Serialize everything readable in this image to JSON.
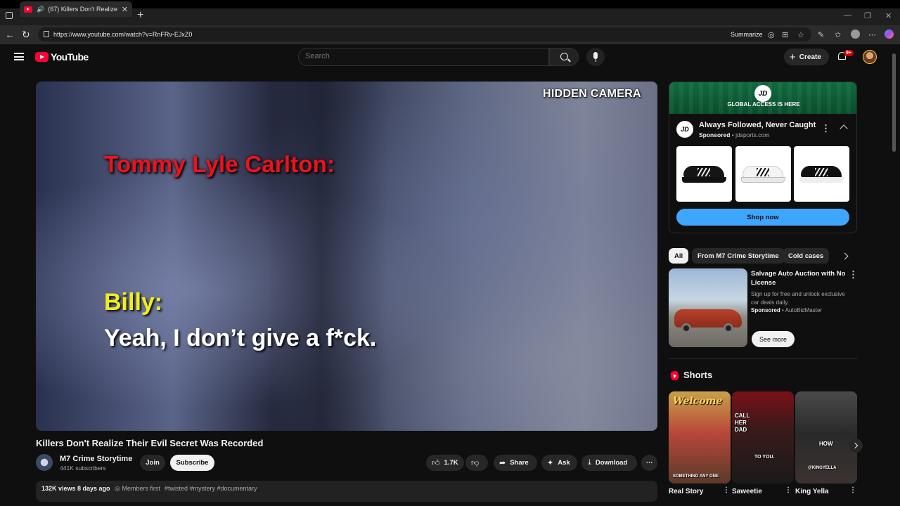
{
  "browser": {
    "tab_title": "(67) Killers Don't Realize Th...",
    "url": "https://www.youtube.com/watch?v=RnFRv-EJxZ0",
    "summarize_label": "Summarize"
  },
  "header": {
    "logo_text": "YouTube",
    "search_placeholder": "Search",
    "create_label": "Create",
    "notification_count": "9+"
  },
  "video": {
    "overlay_label": "HIDDEN CAMERA",
    "caption_speaker1": "Tommy Lyle Carlton:",
    "caption_speaker2": "Billy:",
    "caption_line": "Yeah, I don’t give a f*ck.",
    "title": "Killers Don't Realize Their Evil Secret Was Recorded"
  },
  "channel": {
    "name": "M7 Crime Storytime",
    "subscribers": "441K subscribers",
    "join_label": "Join",
    "subscribe_label": "Subscribe"
  },
  "actions": {
    "likes": "1.7K",
    "share_label": "Share",
    "ask_label": "Ask",
    "download_label": "Download"
  },
  "description": {
    "views_date": "132K views  8 days ago",
    "members": "Members first",
    "tags": "#twisted #mystery #documentary"
  },
  "ad1": {
    "banner_logo": "JD",
    "banner_text": "GLOBAL ACCESS IS HERE",
    "logo": "JD",
    "title": "Always Followed, Never Caught",
    "sponsored": "Sponsored",
    "domain": " • jdsports.com",
    "cta": "Shop now"
  },
  "chips": [
    "All",
    "From M7 Crime Storytime",
    "Cold cases"
  ],
  "ad2": {
    "title": "Salvage Auto Auction with No License",
    "desc": "Sign up for free and unlock exclusive car deals daily.",
    "sponsored": "Sponsored",
    "advertiser": " • AutoBidMaster",
    "cta": "See more"
  },
  "shorts": {
    "label": "Shorts",
    "items": [
      {
        "title": "Real Story",
        "overlay_top": "Welcome",
        "overlay_bottom": "SOMETHING ANY ONE"
      },
      {
        "title": "Saweetie",
        "overlay_top": "CALL HER DAD",
        "overlay_bottom": "TO YOU."
      },
      {
        "title": "King Yella",
        "overlay_top": "HOW",
        "overlay_bottom": "@KINGYELLA"
      }
    ]
  },
  "colors": {
    "background": "#0f0f0f",
    "accent_red": "#ff0033",
    "shop_button": "#3ea6ff"
  }
}
